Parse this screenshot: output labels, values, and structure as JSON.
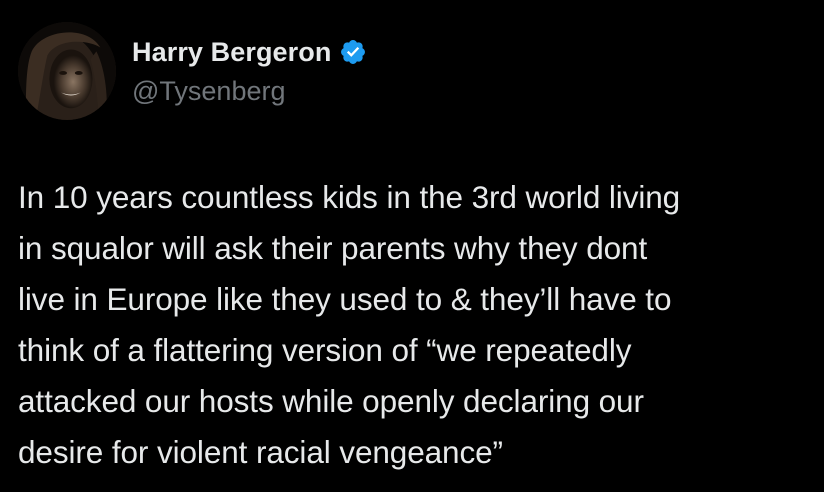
{
  "author": {
    "display_name": "Harry Bergeron",
    "handle": "@Tysenberg",
    "verified": true,
    "avatar_icon": "profile-photo",
    "verified_icon": "verified-badge-icon"
  },
  "tweet": {
    "text": "In 10 years countless kids in the 3rd world living\nin squalor will ask their parents why they dont\nlive in Europe like they used to & they’ll have to\nthink of a flattering version of “we repeatedly\nattacked our hosts while openly declaring our\ndesire for violent racial vengeance”"
  },
  "colors": {
    "background": "#000000",
    "primary_text": "#e7e9ea",
    "secondary_text": "#71767b",
    "verified_blue": "#1d9bf0"
  }
}
